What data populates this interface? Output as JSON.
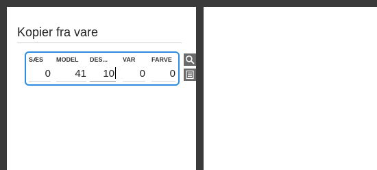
{
  "panel": {
    "title": "Kopier fra vare"
  },
  "item_fields": [
    {
      "label": "SÆS",
      "value": "0"
    },
    {
      "label": "MODEL",
      "value": "41"
    },
    {
      "label": "DES...",
      "value": "10"
    },
    {
      "label": "VAR",
      "value": "0"
    },
    {
      "label": "FARVE",
      "value": "0"
    }
  ],
  "colors": {
    "focus_border": "#2f8ce3",
    "frame": "#3a3a3a",
    "icon_button": "#6b6b6b"
  },
  "icons": {
    "search": "search-icon",
    "list": "list-icon"
  }
}
